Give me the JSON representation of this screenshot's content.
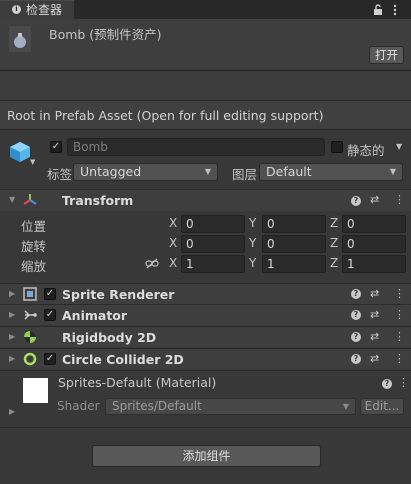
{
  "window": {
    "tab_label": "检查器"
  },
  "header": {
    "asset_name": "Bomb (预制件资产)",
    "open_label": "打开",
    "root_notice": "Root in Prefab Asset (Open for full editing support)"
  },
  "object": {
    "name": "Bomb",
    "static_label": "静态的",
    "tag_label": "标签",
    "tag_value": "Untagged",
    "layer_label": "图层",
    "layer_value": "Default"
  },
  "transform": {
    "title": "Transform",
    "rows": [
      {
        "label": "位置",
        "x": "0",
        "y": "0",
        "z": "0"
      },
      {
        "label": "旋转",
        "x": "0",
        "y": "0",
        "z": "0"
      },
      {
        "label": "缩放",
        "x": "1",
        "y": "1",
        "z": "1"
      }
    ],
    "axis": {
      "x": "X",
      "y": "Y",
      "z": "Z"
    }
  },
  "components": [
    {
      "title": "Sprite Renderer",
      "icon": "sprite-renderer-icon"
    },
    {
      "title": "Animator",
      "icon": "animator-icon"
    },
    {
      "title": "Rigidbody 2D",
      "icon": "rigidbody-icon"
    },
    {
      "title": "Circle Collider 2D",
      "icon": "circle-collider-icon"
    }
  ],
  "material": {
    "name": "Sprites-Default (Material)",
    "shader_label": "Shader",
    "shader_value": "Sprites/Default",
    "edit_label": "Edit..."
  },
  "add_component_label": "添加组件",
  "colors": {
    "background": "#383838",
    "accent_cyan": "#4fc3f7",
    "rigidbody_green": "#8bd34a",
    "collider_green": "#a8e063"
  }
}
